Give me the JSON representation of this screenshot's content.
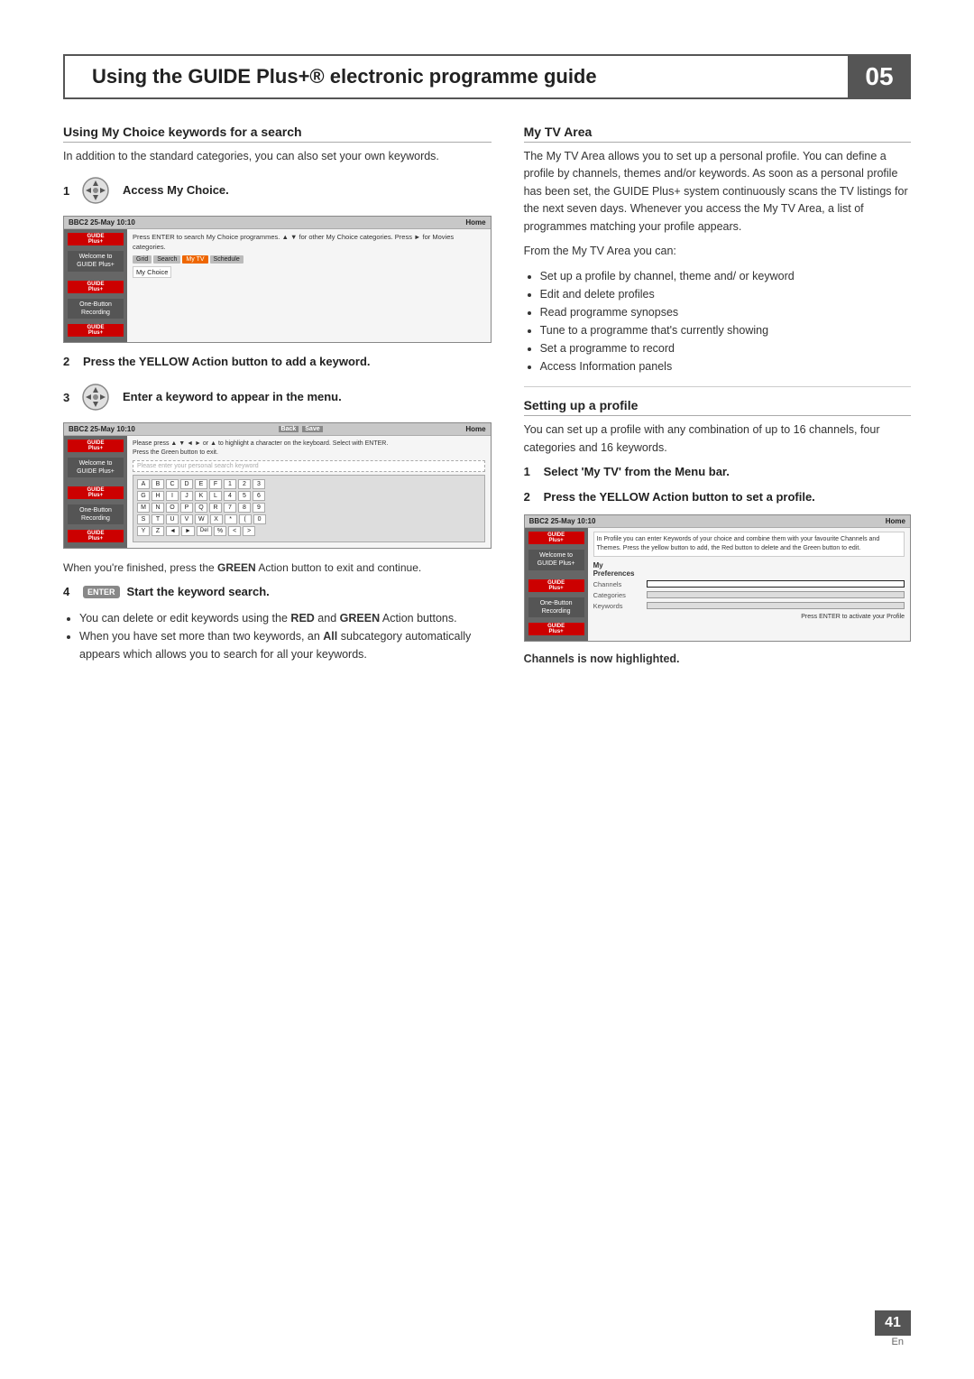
{
  "header": {
    "title": "Using the GUIDE Plus+® electronic programme guide",
    "chapter_number": "05"
  },
  "left_column": {
    "section_title": "Using My Choice keywords for a search",
    "intro_text": "In addition to the standard categories, you can also set your own keywords.",
    "step1": {
      "number": "1",
      "label": "Access My Choice.",
      "icon": "nav-circle"
    },
    "screen1": {
      "top_bar_left": "BBC2  25-May  10:10",
      "top_bar_right": "Home",
      "main_text": "Press ENTER to search My Choice programmes.  ▲ ▼ for other My Choice categories. Press ► for Movies categories.",
      "nav_buttons": [
        "Grid",
        "Search",
        "My TV",
        "Schedule"
      ],
      "active_button": "My TV",
      "sub_tab": "My Choice",
      "sidebar_logo": "GUIDE Plus+",
      "sidebar_items": [
        "Welcome to\nGUIDE Plus+",
        "One-Button\nRecording"
      ]
    },
    "step2": {
      "number": "2",
      "label": "Press the YELLOW Action button to add a keyword."
    },
    "step3": {
      "number": "3",
      "label": "Enter a keyword to appear in the menu.",
      "icon": "nav-circle"
    },
    "screen2": {
      "top_bar_left": "BBC2  25-May  10:10",
      "back_button": "Back",
      "save_button": "Save",
      "top_bar_right": "Home",
      "main_text": "Please press ▲ ▼ ◄ ► or ▲ to highlight a character on the keyboard. Select with ENTER.\nPress the Green button to exit.",
      "input_placeholder": "Please enter your personal search keyword",
      "keyboard_rows": [
        [
          "A",
          "B",
          "C",
          "D",
          "E",
          "F",
          "1",
          "2",
          "3"
        ],
        [
          "G",
          "H",
          "I",
          "J",
          "K",
          "L",
          "4",
          "5",
          "6"
        ],
        [
          "M",
          "N",
          "O",
          "P",
          "Q",
          "R",
          "7",
          "8",
          "9"
        ],
        [
          "S",
          "T",
          "U",
          "V",
          "W",
          "X",
          "*",
          "(",
          "0"
        ],
        [
          "Y",
          "Z",
          "",
          "",
          "◄",
          "►",
          "Del",
          "%",
          "<",
          ">"
        ]
      ],
      "sidebar_logo": "GUIDE Plus+",
      "sidebar_items": [
        "Welcome to\nGUIDE Plus+",
        "One-Button\nRecording"
      ]
    },
    "after_screen2": "When you're finished, press the GREEN Action button to exit and continue.",
    "step4": {
      "number": "4",
      "icon_label": "ENTER",
      "label": "Start the keyword search."
    },
    "bullets": [
      "You can delete or edit keywords using the RED and GREEN Action buttons.",
      "When you have set more than two keywords, an All subcategory automatically appears which allows you to search for all your keywords."
    ]
  },
  "right_column": {
    "my_tv_area": {
      "section_title": "My TV Area",
      "body1": "The My TV Area allows you to set up a personal profile. You can define a profile by channels, themes and/or keywords. As soon as a personal profile has been set, the GUIDE Plus+ system continuously scans the TV listings for the next seven days. Whenever you access the My TV Area, a list of programmes matching your profile appears.",
      "from_text": "From the My TV Area you can:",
      "bullets": [
        "Set up a profile by channel, theme and/ or keyword",
        "Edit and delete profiles",
        "Read programme synopses",
        "Tune to a programme that's currently showing",
        "Set a programme to record",
        "Access Information panels"
      ]
    },
    "setting_up": {
      "section_title": "Setting up a profile",
      "body1": "You can set up a profile with any combination of up to 16 channels, four categories and 16 keywords.",
      "step1": {
        "number": "1",
        "label": "Select 'My TV' from the Menu bar."
      },
      "step2": {
        "number": "2",
        "label": "Press the YELLOW Action button to set a profile."
      },
      "profile_screen": {
        "top_bar_left": "BBC2  25-May  10:10",
        "top_bar_right": "Home",
        "info_text": "In Profile you can enter Keywords of your choice and combine them with your favourite Channels and Themes. Press the yellow button to add, the Red button to delete and the Green button to edit.",
        "sidebar_logo": "GUIDE Plus+",
        "sidebar_items": [
          "Welcome to\nGUIDE Plus+",
          "One-Button\nRecording"
        ],
        "rows": [
          {
            "label": "My Preferences",
            "type": "header"
          },
          {
            "label": "Channels",
            "type": "bar",
            "highlighted": true
          },
          {
            "label": "Categories",
            "type": "bar",
            "highlighted": false
          },
          {
            "label": "Keywords",
            "type": "bar",
            "highlighted": false
          }
        ]
      },
      "channels_highlighted": "Channels is now highlighted."
    }
  },
  "page_number": "41",
  "page_lang": "En"
}
